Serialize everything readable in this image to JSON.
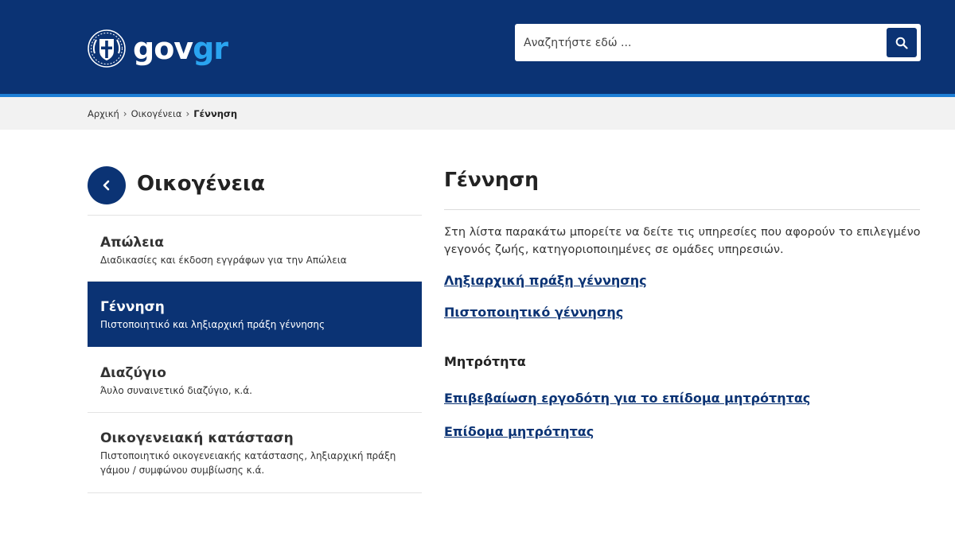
{
  "header": {
    "logo_gov": "gov",
    "logo_gr": "gr",
    "emblem_icon": "greek-emblem-icon",
    "search_placeholder": "Αναζητήστε εδώ ...",
    "search_icon": "search-icon",
    "colors": {
      "primary": "#0b3374",
      "accent": "#2aa4f0",
      "stripe": "#1e7fd6"
    }
  },
  "breadcrumb": {
    "items": [
      "Αρχική",
      "Οικογένεια"
    ],
    "current": "Γέννηση"
  },
  "sidebar": {
    "back_icon": "chevron-left-icon",
    "title": "Οικογένεια",
    "items": [
      {
        "title": "Απώλεια",
        "desc": "Διαδικασίες και έκδοση εγγράφων για την Απώλεια"
      },
      {
        "title": "Γέννηση",
        "desc": "Πιστοποιητικό και ληξιαρχική πράξη γέννησης",
        "active": true
      },
      {
        "title": "Διαζύγιο",
        "desc": "Άυλο συναινετικό διαζύγιο, κ.ά."
      },
      {
        "title": "Οικογενειακή κατάσταση",
        "desc": "Πιστοποιητικό οικογενειακής κατάστασης, ληξιαρχική πράξη γάμου / συμφώνου συμβίωσης κ.ά."
      }
    ]
  },
  "main": {
    "title": "Γέννηση",
    "intro": "Στη λίστα παρακάτω μπορείτε να δείτε τις υπηρεσίες που αφορούν το επιλεγμένο γεγονός ζωής, κατηγοριοποιημένες σε ομάδες υπηρεσιών.",
    "links": [
      "Ληξιαρχική πράξη γέννησης",
      "Πιστοποιητικό γέννησης"
    ],
    "groups": [
      {
        "title": "Μητρότητα",
        "links": [
          "Επιβεβαίωση εργοδότη για το επίδομα μητρότητας",
          "Επίδομα μητρότητας"
        ]
      }
    ]
  }
}
